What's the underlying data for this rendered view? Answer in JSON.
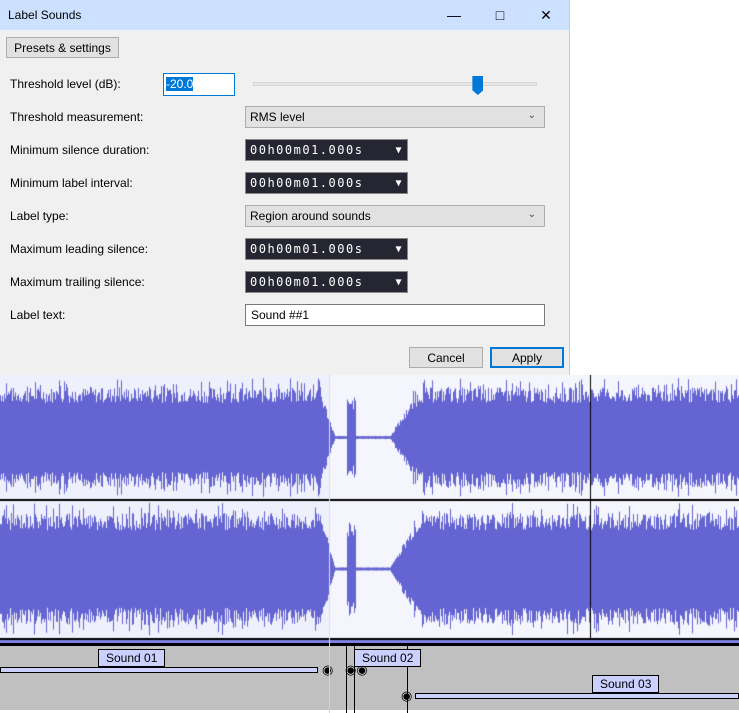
{
  "dialog": {
    "title": "Label Sounds",
    "presets_label": "Presets & settings",
    "threshold_label": "Threshold level (dB):",
    "threshold_value": "-20.0",
    "threshold_slider_fraction": 0.79,
    "measurement_label": "Threshold measurement:",
    "measurement_value": "RMS level",
    "min_silence_label": "Minimum silence duration:",
    "min_silence_value": "00h00m01.000s",
    "min_interval_label": "Minimum label interval:",
    "min_interval_value": "00h00m01.000s",
    "label_type_label": "Label type:",
    "label_type_value": "Region around sounds",
    "max_leading_label": "Maximum leading silence:",
    "max_leading_value": "00h00m01.000s",
    "max_trailing_label": "Maximum trailing silence:",
    "max_trailing_value": "00h00m01.000s",
    "label_text_label": "Label text:",
    "label_text_value": "Sound ##1",
    "cancel_label": "Cancel",
    "apply_label": "Apply"
  },
  "labels": [
    {
      "text": "Sound 01"
    },
    {
      "text": "Sound 02"
    },
    {
      "text": "Sound 03"
    }
  ],
  "colors": {
    "waveform": "#6464d2",
    "track_bg": "#eef0fc",
    "label_bg": "#ccd0ff"
  }
}
